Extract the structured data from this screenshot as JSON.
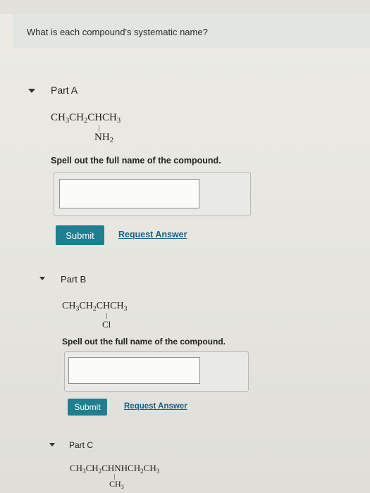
{
  "question": {
    "text": "What is each compound's systematic name?"
  },
  "parts": [
    {
      "title": "Part A",
      "formula": {
        "main_segments": [
          "CH",
          "3",
          "CH",
          "2",
          "CHCH",
          "3"
        ],
        "branch_prefix": "NH",
        "branch_sub": "2"
      },
      "prompt": "Spell out the full name of the compound.",
      "answer_value": "",
      "submit_label": "Submit",
      "request_label": "Request Answer"
    },
    {
      "title": "Part B",
      "formula": {
        "main_segments": [
          "CH",
          "3",
          "CH",
          "2",
          "CHCH",
          "3"
        ],
        "branch_prefix": "Cl",
        "branch_sub": ""
      },
      "prompt": "Spell out the full name of the compound.",
      "answer_value": "",
      "submit_label": "Submit",
      "request_label": "Request Answer"
    },
    {
      "title": "Part C",
      "formula": {
        "main_segments": [
          "CH",
          "3",
          "CH",
          "2",
          "CHNHCH",
          "2",
          "CH",
          "3"
        ],
        "branch_prefix": "CH",
        "branch_sub": "3"
      }
    }
  ],
  "colors": {
    "submit_bg": "#1f7e8f",
    "link": "#1b5f86"
  }
}
